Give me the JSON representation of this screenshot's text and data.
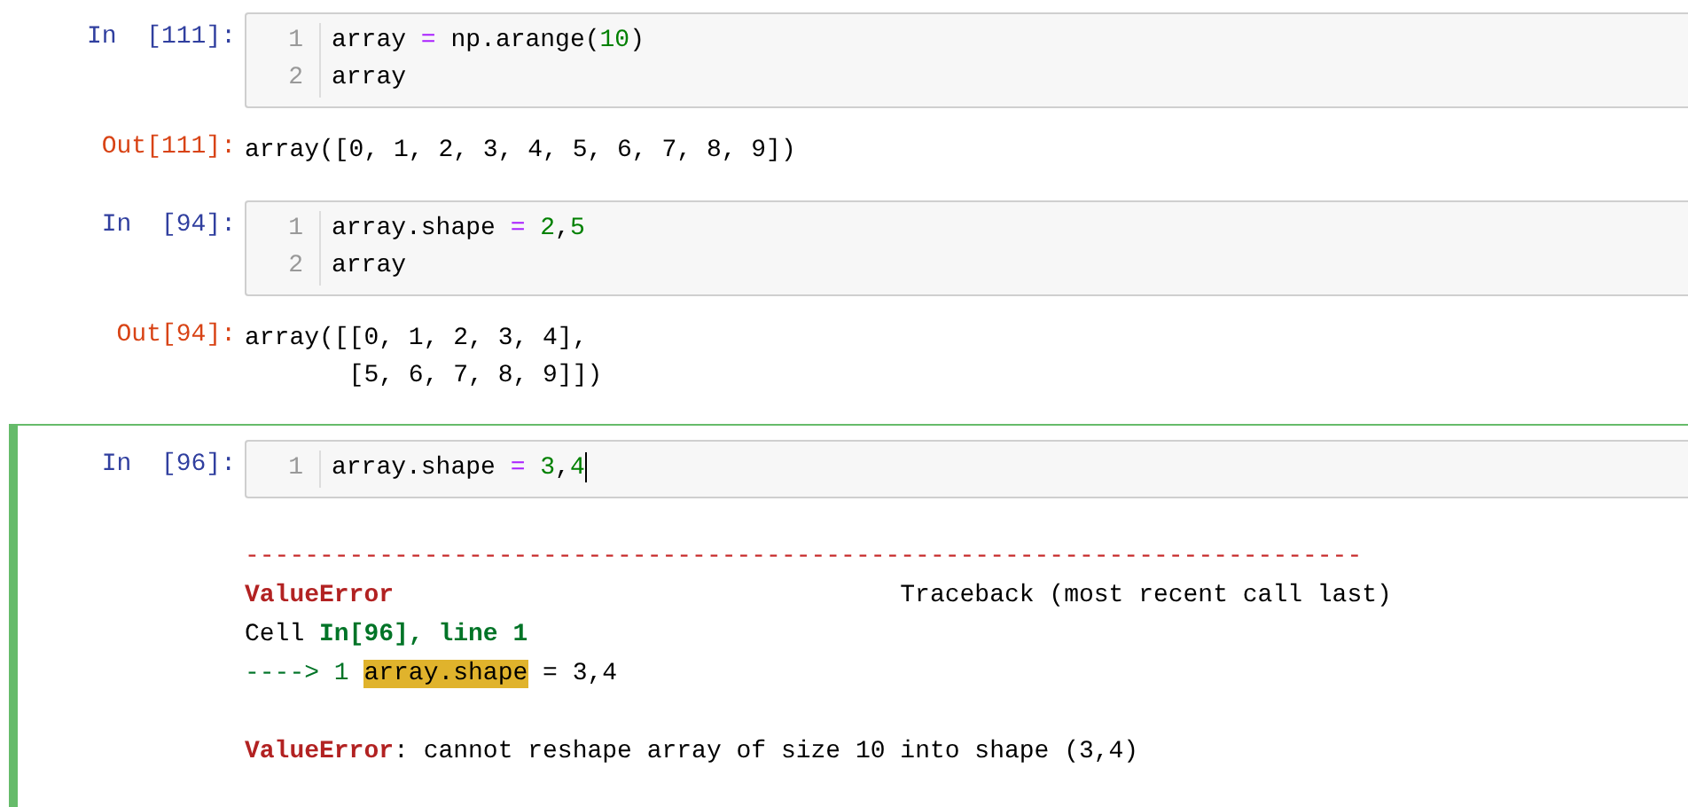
{
  "cells": [
    {
      "selected": false,
      "prompt": "In  [111]:",
      "cursor": false,
      "code": [
        {
          "number": "1",
          "tokens": [
            {
              "text": "array",
              "kind": "plain"
            },
            {
              "text": " = ",
              "kind": "op"
            },
            {
              "text": "np.arange(",
              "kind": "plain"
            },
            {
              "text": "10",
              "kind": "num"
            },
            {
              "text": ")",
              "kind": "plain"
            }
          ]
        },
        {
          "number": "2",
          "tokens": [
            {
              "text": "array",
              "kind": "plain"
            }
          ]
        }
      ],
      "output": {
        "kind": "result",
        "prompt": "Out[111]:",
        "lines": [
          [
            {
              "text": "array([0, 1, 2, 3, 4, 5, 6, 7, 8, 9])",
              "kind": "plain"
            }
          ]
        ]
      }
    },
    {
      "selected": false,
      "prompt": "In  [94]:",
      "cursor": false,
      "code": [
        {
          "number": "1",
          "tokens": [
            {
              "text": "array.shape",
              "kind": "plain"
            },
            {
              "text": " = ",
              "kind": "op"
            },
            {
              "text": "2",
              "kind": "num"
            },
            {
              "text": ",",
              "kind": "plain"
            },
            {
              "text": "5",
              "kind": "num"
            }
          ]
        },
        {
          "number": "2",
          "tokens": [
            {
              "text": "array",
              "kind": "plain"
            }
          ]
        }
      ],
      "output": {
        "kind": "result",
        "prompt": "Out[94]:",
        "lines": [
          [
            {
              "text": "array([[0, 1, 2, 3, 4],",
              "kind": "plain"
            }
          ],
          [
            {
              "text": "       [5, 6, 7, 8, 9]])",
              "kind": "plain"
            }
          ]
        ]
      }
    },
    {
      "selected": true,
      "prompt": "In  [96]:",
      "cursor": true,
      "code": [
        {
          "number": "1",
          "tokens": [
            {
              "text": "array.shape",
              "kind": "plain"
            },
            {
              "text": " = ",
              "kind": "op"
            },
            {
              "text": "3",
              "kind": "num"
            },
            {
              "text": ",",
              "kind": "plain"
            },
            {
              "text": "4",
              "kind": "num"
            }
          ]
        }
      ],
      "output": {
        "kind": "error",
        "lines": [
          [
            {
              "text": "---------------------------------------------------------------------------",
              "kind": "rule"
            }
          ],
          [
            {
              "text": "ValueError",
              "kind": "err"
            },
            {
              "text": "Traceback (most recent call last)",
              "kind": "far"
            }
          ],
          [
            {
              "text": "Cell ",
              "kind": "plain"
            },
            {
              "text": "In[96], line 1",
              "kind": "loc"
            }
          ],
          [
            {
              "text": "----> 1 ",
              "kind": "arrow"
            },
            {
              "text": "array.shape",
              "kind": "hl"
            },
            {
              "text": " = 3,4",
              "kind": "plain"
            }
          ],
          [
            {
              "text": "ValueError",
              "kind": "err"
            },
            {
              "text": ": cannot reshape array of size 10 into shape (3,4)",
              "kind": "plain"
            }
          ]
        ]
      }
    }
  ]
}
